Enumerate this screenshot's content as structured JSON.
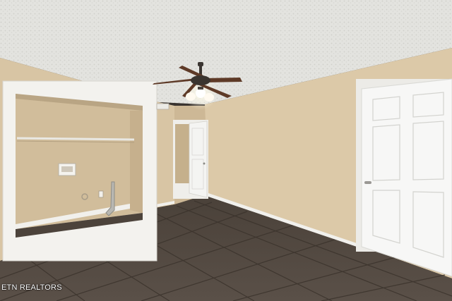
{
  "photo": {
    "description_tags": [
      "ceiling-fan",
      "laundry-closet",
      "interior-door",
      "tile-floor"
    ],
    "colors": {
      "ceiling": "#e4e4e0",
      "wall": "#d9c6a6",
      "wall_shadow": "#cbb593",
      "closet_wall": "#d2be9c",
      "trim": "#f2f2ef",
      "door": "#f7f7f6",
      "floor": "#4d443c"
    }
  },
  "watermark": {
    "text": "ETN REALTORS"
  }
}
